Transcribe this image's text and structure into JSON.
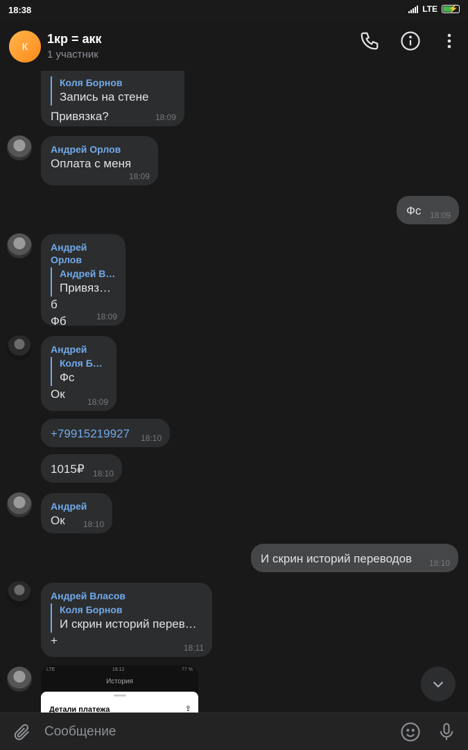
{
  "status": {
    "time": "18:38",
    "network": "LTE"
  },
  "header": {
    "avatar_letter": "К",
    "title": "1кр = акк",
    "subtitle": "1 участник"
  },
  "messages": {
    "m1": {
      "quote_name": "Коля Борнов",
      "quote_text": "Запись на стене",
      "text": "Привязка?",
      "time": "18:09"
    },
    "m2": {
      "sender": "Андрей Орлов",
      "text": "Оплата с меня",
      "time": "18:09"
    },
    "m3": {
      "text": "Фс",
      "time": "18:09"
    },
    "m4": {
      "sender": "Андрей Орлов",
      "quote_name": "Андрей Вл…",
      "quote_text": "Привязк…",
      "line1": "б",
      "line2": "Фб",
      "time": "18:09"
    },
    "m5": {
      "sender": "Андрей",
      "quote_name": "Коля Борн…",
      "quote_text": "Фс",
      "text": "Ок",
      "time": "18:09"
    },
    "m6": {
      "text": "+79915219927",
      "time": "18:10"
    },
    "m7": {
      "text": "1015₽",
      "time": "18:10"
    },
    "m8": {
      "sender": "Андрей",
      "text": "Ок",
      "time": "18:10"
    },
    "m9": {
      "text": "И скрин историй переводов",
      "time": "18:10"
    },
    "m10": {
      "sender": "Андрей Власов",
      "quote_name": "Коля Борнов",
      "quote_text": "И скрин историй перево…",
      "text": "+",
      "time": "18:11"
    },
    "m11": {
      "preview_status": "LTE",
      "preview_time": "18:12",
      "preview_battery": "77 %",
      "preview_title": "История",
      "preview_details": "Детали платежа"
    }
  },
  "composer": {
    "placeholder": "Сообщение"
  }
}
